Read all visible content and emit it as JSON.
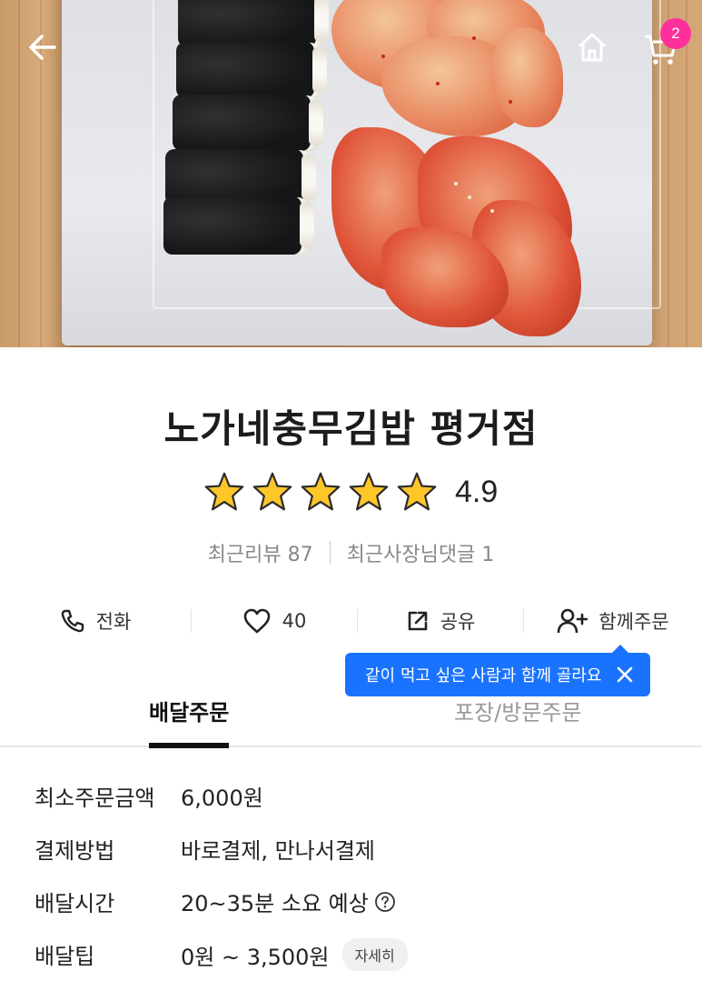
{
  "hero": {
    "back_icon": "arrow-left-icon",
    "home_icon": "home-icon",
    "cart_icon": "cart-icon",
    "cart_count": "2"
  },
  "store": {
    "name": "노가네충무김밥 평거점",
    "rating": "4.9",
    "stars": 5,
    "recent_reviews": "최근리뷰 87",
    "owner_replies": "최근사장님댓글 1"
  },
  "actions": {
    "call": "전화",
    "like_count": "40",
    "share": "공유",
    "group_order": "함께주문"
  },
  "tooltip": {
    "text": "같이 먹고 싶은 사람과 함께 골라요"
  },
  "tabs": [
    {
      "label": "배달주문",
      "active": true
    },
    {
      "label": "포장/방문주문",
      "active": false
    }
  ],
  "info": [
    {
      "label": "최소주문금액",
      "value": "6,000원"
    },
    {
      "label": "결제방법",
      "value": "바로결제, 만나서결제"
    },
    {
      "label": "배달시간",
      "value": "20~35분 소요 예상"
    },
    {
      "label": "배달팁",
      "value": "0원 ~ 3,500원",
      "button": "자세히"
    }
  ],
  "colors": {
    "badge": "#ff2f9b",
    "tooltip": "#1a73ff",
    "star": "#ffc629"
  }
}
